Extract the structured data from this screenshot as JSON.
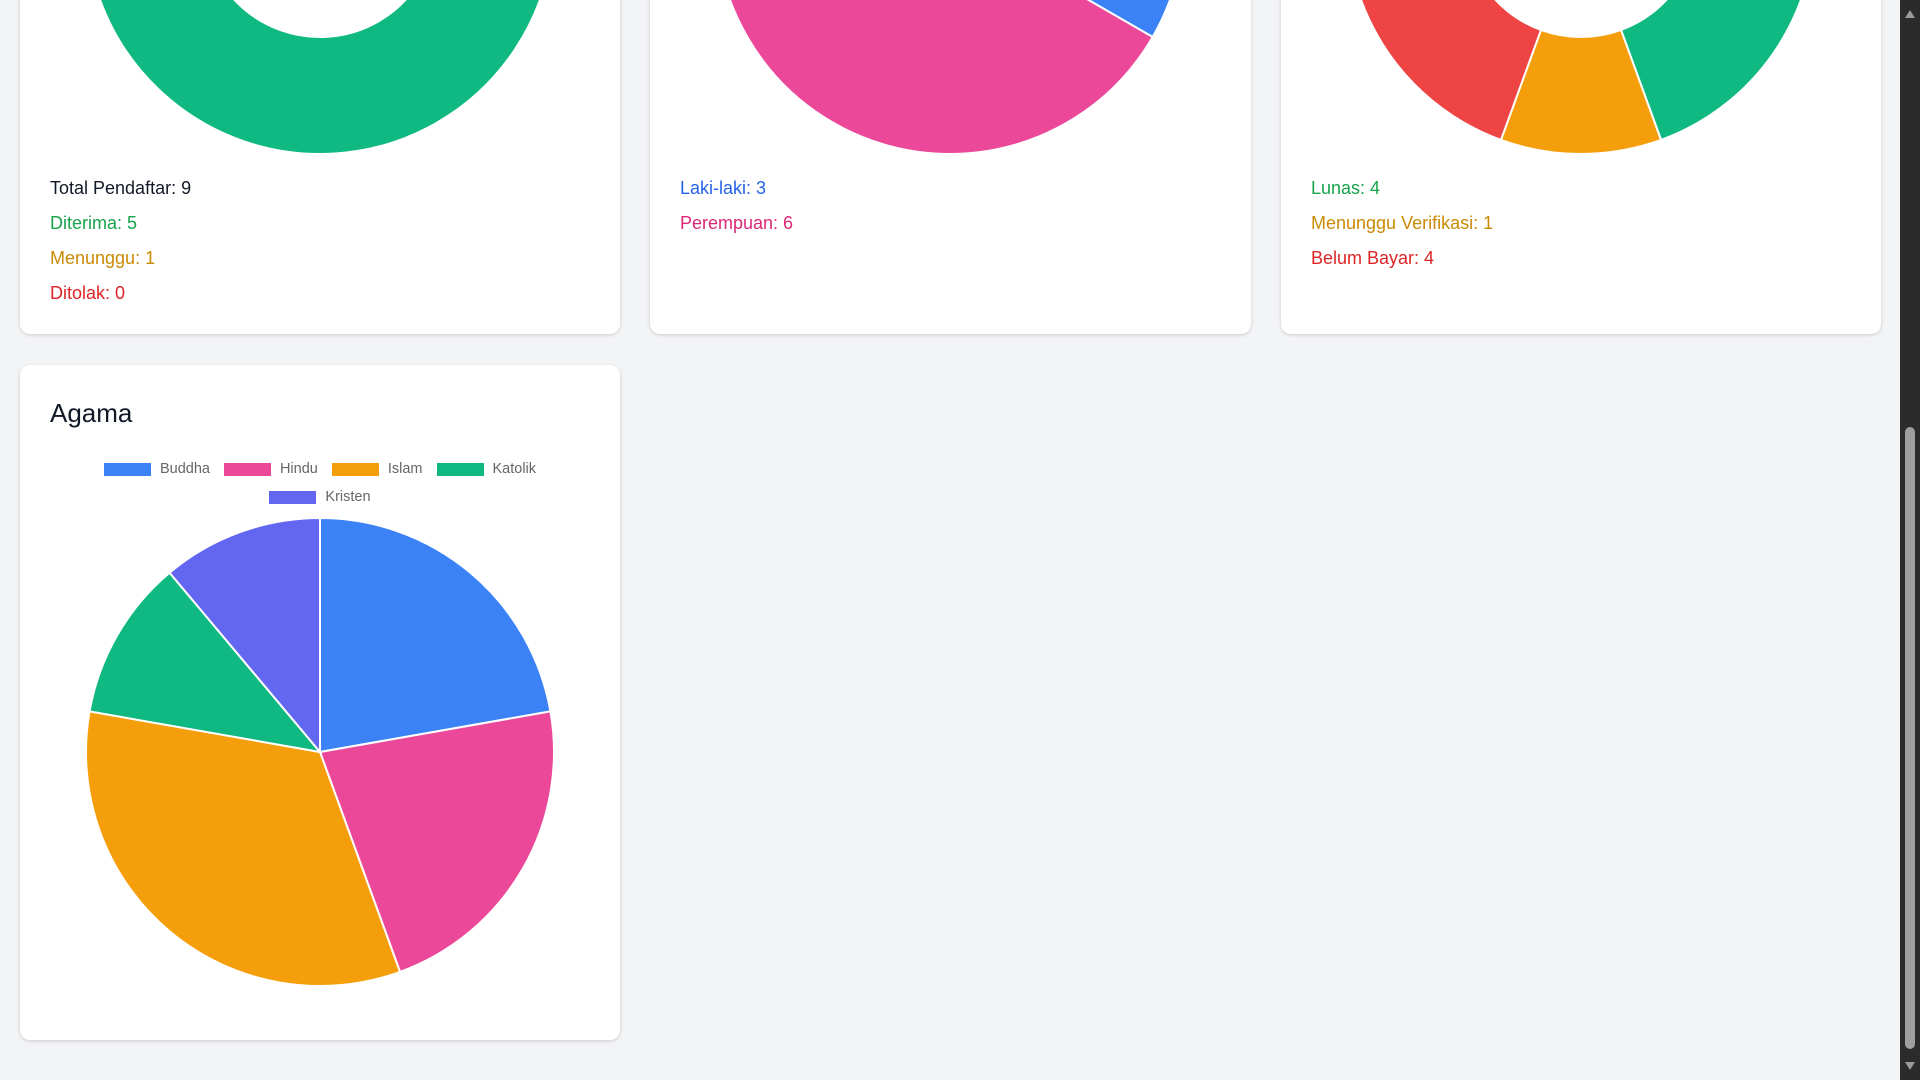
{
  "colors": {
    "blue": "#3b82f6",
    "pink": "#ec4899",
    "amber": "#f59e0b",
    "green": "#10b981",
    "red": "#ef4444",
    "indigo": "#6366f1",
    "page_background": "#f3f4f6"
  },
  "status_card": {
    "total_label": "Total Pendaftar: 9",
    "accepted_label": "Diterima: 5",
    "waiting_label": "Menunggu: 1",
    "rejected_label": "Ditolak: 0"
  },
  "gender_card": {
    "male_label": "Laki-laki: 3",
    "female_label": "Perempuan: 6"
  },
  "payment_card": {
    "paid_label": "Lunas: 4",
    "pending_label": "Menunggu Verifikasi: 1",
    "unpaid_label": "Belum Bayar: 4"
  },
  "religion_card": {
    "title": "Agama"
  },
  "chart_data": [
    {
      "type": "pie",
      "variant": "doughnut",
      "partially_visible": true,
      "categories": [
        "Diterima",
        "Menunggu",
        "Ditolak"
      ],
      "values": [
        5,
        1,
        0
      ],
      "colors": [
        "#10b981",
        "#f59e0b",
        "#ef4444"
      ]
    },
    {
      "type": "pie",
      "partially_visible": true,
      "categories": [
        "Laki-laki",
        "Perempuan"
      ],
      "values": [
        3,
        6
      ],
      "colors": [
        "#3b82f6",
        "#ec4899"
      ]
    },
    {
      "type": "pie",
      "variant": "doughnut",
      "partially_visible": true,
      "categories": [
        "Lunas",
        "Menunggu Verifikasi",
        "Belum Bayar"
      ],
      "values": [
        4,
        1,
        4
      ],
      "colors": [
        "#10b981",
        "#f59e0b",
        "#ef4444"
      ]
    },
    {
      "type": "pie",
      "title": "Agama",
      "legend": "top",
      "categories": [
        "Buddha",
        "Hindu",
        "Islam",
        "Katolik",
        "Kristen"
      ],
      "values": [
        2,
        2,
        3,
        1,
        1
      ],
      "colors": [
        "#3b82f6",
        "#ec4899",
        "#f59e0b",
        "#10b981",
        "#6366f1"
      ]
    }
  ],
  "scrollbar": {
    "up_icon": "triangle-up-icon",
    "down_icon": "triangle-down-icon"
  }
}
